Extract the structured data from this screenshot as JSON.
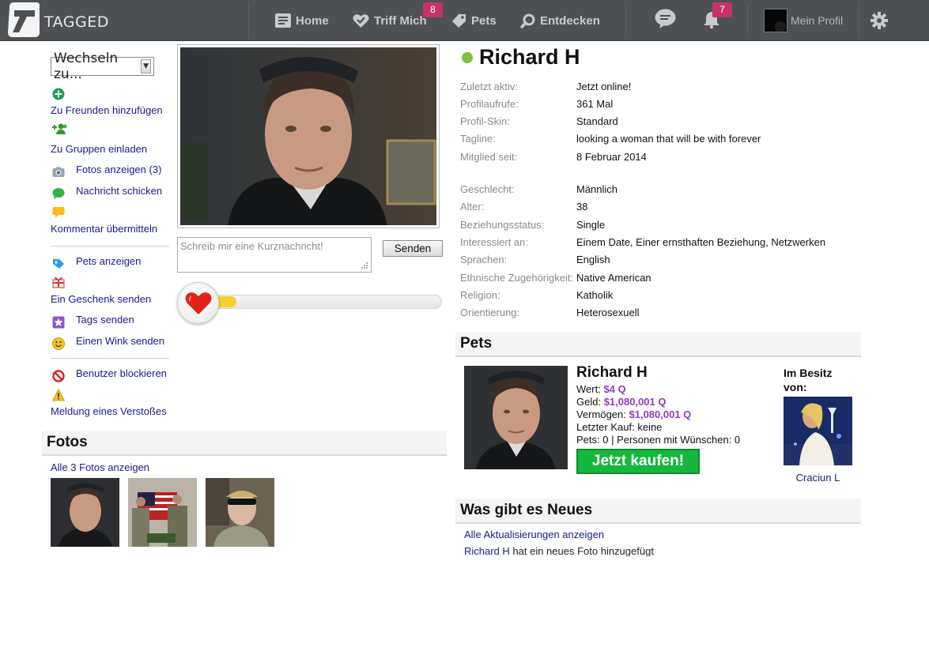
{
  "app": {
    "logo_text": "TAGGED"
  },
  "nav": {
    "home": "Home",
    "meet_me": "Triff Mich",
    "meet_me_badge": "8",
    "pets": "Pets",
    "browse": "Entdecken",
    "notifications_badge": "7",
    "my_profile": "Mein Profil"
  },
  "sidebar": {
    "switcher_label": "Wechseln zu...",
    "actions": {
      "add_friend": "Zu Freunden hinzufügen",
      "invite_groups": "Zu Gruppen einladen",
      "view_photos": "Fotos anzeigen (3)",
      "send_message": "Nachricht schicken",
      "post_comment": "Kommentar übermitteln",
      "view_pets": "Pets anzeigen",
      "send_gift": "Ein Geschenk senden",
      "send_tags": "Tags senden",
      "send_wink": "Einen Wink senden",
      "block_user": "Benutzer blockieren",
      "report_abuse": "Meldung eines Verstoßes"
    }
  },
  "shoutbox": {
    "placeholder": "Schreib mir eine Kurznachricht!",
    "send_label": "Senden"
  },
  "meter": {
    "level_percent": 10
  },
  "profile": {
    "name": "Richard H",
    "status_color": "#7cc142",
    "details": [
      {
        "label": "Zuletzt aktiv:",
        "value": "Jetzt online!"
      },
      {
        "label": "Profilaufrufe:",
        "value": "361 Mal"
      },
      {
        "label": "Profil-Skin:",
        "value": "Standard"
      },
      {
        "label": "Tagline:",
        "value": "looking a woman that will be with forever"
      },
      {
        "label": "Mitglied seit:",
        "value": "8 Februar 2014"
      },
      {
        "label": "Geschlecht:",
        "value": "Männlich"
      },
      {
        "label": "Alter:",
        "value": "38"
      },
      {
        "label": "Beziehungsstatus:",
        "value": "Single"
      },
      {
        "label": "Interessiert an:",
        "value": "Einem Date, Einer ernsthaften Beziehung, Netzwerken"
      },
      {
        "label": "Sprachen:",
        "value": "English"
      },
      {
        "label": "Ethnische Zugehörigkeit:",
        "value": "Native American"
      },
      {
        "label": "Religion:",
        "value": "Katholik"
      },
      {
        "label": "Orientierung:",
        "value": "Heterosexuell"
      }
    ]
  },
  "photos": {
    "title": "Fotos",
    "view_all": "Alle 3 Fotos anzeigen"
  },
  "pets": {
    "title": "Pets",
    "name": "Richard H",
    "value_label": "Wert:",
    "value": "$4 Q",
    "cash_label": "Geld:",
    "cash": "$1,080,001 Q",
    "assets_label": "Vermögen:",
    "assets": "$1,080,001 Q",
    "last_purchase": "Letzter Kauf: keine",
    "counts": "Pets: 0 | Personen mit Wünschen: 0",
    "buy_label": "Jetzt kaufen!",
    "owned_by_label": "Im Besitz von:",
    "owner_name": "Craciun L",
    "value_color": "#8d3cc4"
  },
  "news": {
    "title": "Was gibt es Neues",
    "view_all": "Alle Aktualisierungen anzeigen",
    "item_link": "Richard H",
    "item_text": " hat ein neues Foto hinzugefügt"
  }
}
